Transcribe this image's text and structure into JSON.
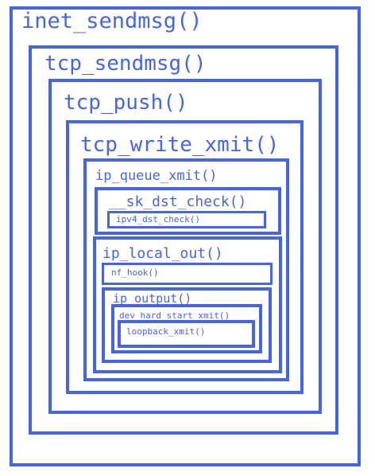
{
  "diagram": {
    "accent_color": "#4665e5",
    "nodes": {
      "inet_sendmsg": "inet_sendmsg()",
      "tcp_sendmsg": "tcp_sendmsg()",
      "tcp_push": "tcp_push()",
      "tcp_write_xmit": "tcp_write_xmit()",
      "ip_queue_xmit": "ip_queue_xmit()",
      "sk_dst_check": "__sk_dst_check()",
      "ipv4_dst_check": "ipv4_dst_check()",
      "ip_local_out": "ip_local_out()",
      "nf_hook": "nf_hook()",
      "ip_output": "ip_output()",
      "dev_hard_start_xmit": "dev_hard_start_xmit()",
      "loopback_xmit": "loopback_xmit()"
    }
  }
}
